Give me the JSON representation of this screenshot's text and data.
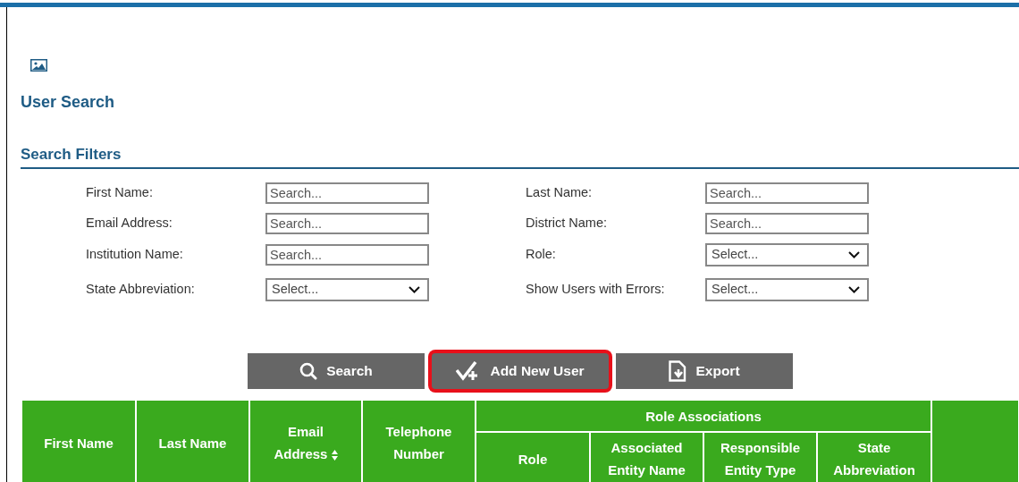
{
  "page": {
    "title": "User Search"
  },
  "section": {
    "title": "Search Filters"
  },
  "filter_rows": [
    {
      "left": {
        "label": "First Name:",
        "kind": "text",
        "placeholder": "Search..."
      },
      "right": {
        "label": "Last Name:",
        "kind": "text",
        "placeholder": "Search..."
      }
    },
    {
      "left": {
        "label": "Email Address:",
        "kind": "text",
        "placeholder": "Search..."
      },
      "right": {
        "label": "District Name:",
        "kind": "text",
        "placeholder": "Search..."
      }
    },
    {
      "left": {
        "label": "Institution Name:",
        "kind": "text",
        "placeholder": "Search..."
      },
      "right": {
        "label": "Role:",
        "kind": "select",
        "value": "Select..."
      }
    },
    {
      "left": {
        "label": "State Abbreviation:",
        "kind": "select",
        "value": "Select..."
      },
      "right": {
        "label": "Show Users with Errors:",
        "kind": "select",
        "value": "Select..."
      }
    }
  ],
  "buttons": [
    {
      "label": "Search",
      "kind": "search",
      "highlighted": false
    },
    {
      "label": "Add New User",
      "kind": "add-user",
      "highlighted": true
    },
    {
      "label": "Export",
      "kind": "export",
      "highlighted": false
    }
  ],
  "table": {
    "columns": [
      {
        "label": "First Name"
      },
      {
        "label": "Last Name"
      },
      {
        "label": "Email Address",
        "sortable": true
      },
      {
        "label": "Telephone Number"
      },
      {
        "label": "Role Associations",
        "children": [
          {
            "label": "Role"
          },
          {
            "label": "Associated Entity Name"
          },
          {
            "label": "Responsible Entity Type"
          },
          {
            "label": "State Abbreviation"
          }
        ]
      }
    ]
  }
}
